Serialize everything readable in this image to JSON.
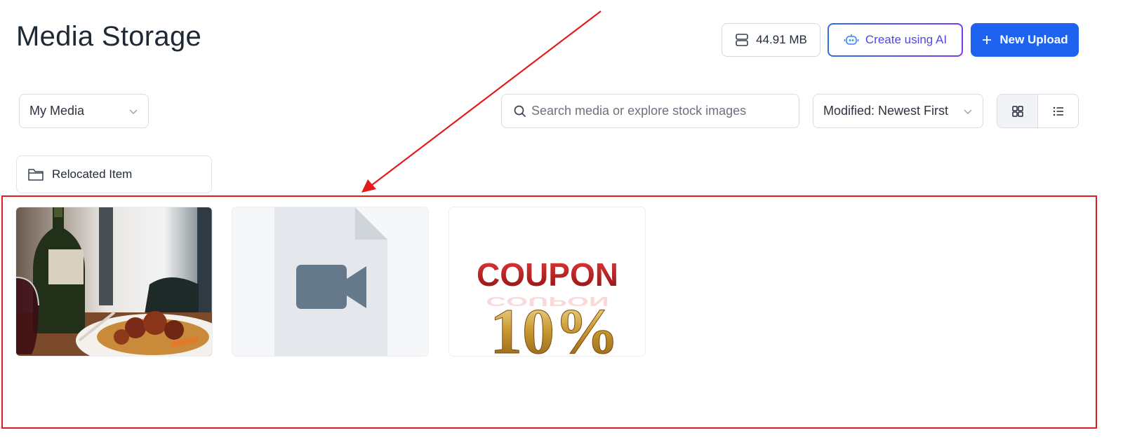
{
  "page": {
    "title": "Media Storage"
  },
  "header": {
    "storage_used": "44.91 MB",
    "ai_button_label": "Create using AI",
    "upload_button_label": "New Upload"
  },
  "filters": {
    "media_source": "My Media",
    "search_placeholder": "Search media or explore stock images",
    "sort_value": "Modified: Newest First",
    "view_mode": "grid"
  },
  "folders": [
    {
      "name": "Relocated Item"
    }
  ],
  "media_items": [
    {
      "type": "image",
      "description_icon": "food-photo"
    },
    {
      "type": "video",
      "description_icon": "video-file-icon"
    },
    {
      "type": "image",
      "text_in_image": [
        "COUPON",
        "10%"
      ]
    }
  ],
  "colors": {
    "primary": "#1e63f0",
    "ai_gradient_start": "#2f6fe0",
    "ai_gradient_end": "#7c3aed",
    "annotation": "#e31b1b",
    "coupon_red": "#c81e1e",
    "coupon_gold": "#c8962e"
  }
}
